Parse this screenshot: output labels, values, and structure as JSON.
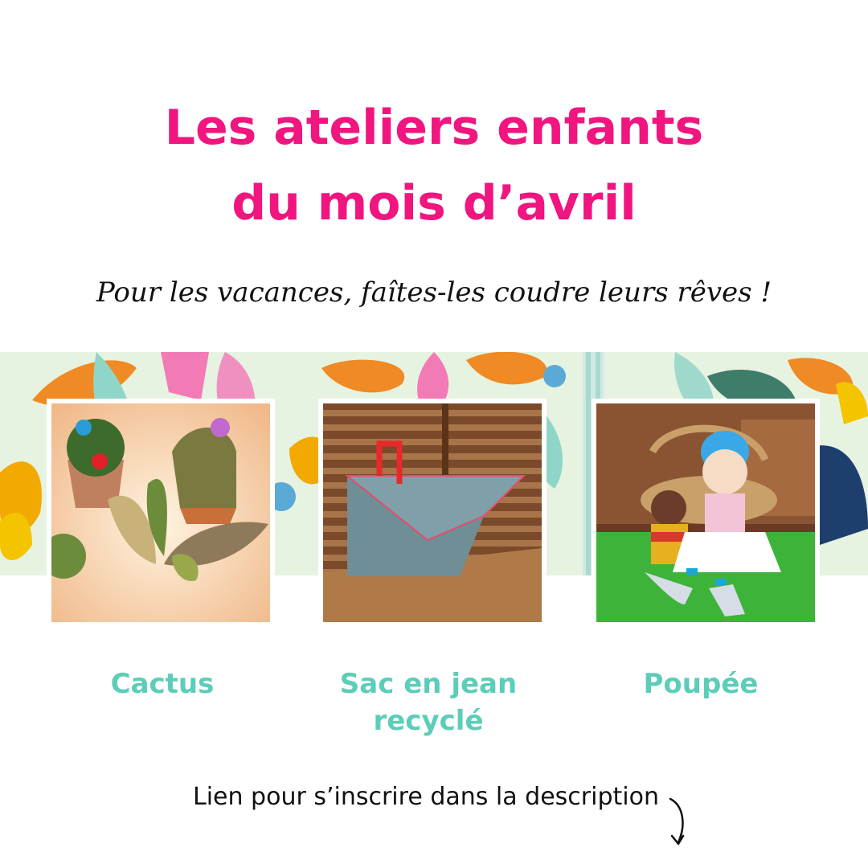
{
  "title": {
    "line1": "Les ateliers enfants",
    "line2": "du mois d’avril"
  },
  "subtitle": "Pour les vacances, faîtes-les coudre leurs rêves !",
  "workshops": [
    {
      "line1": "Cactus",
      "line2": ""
    },
    {
      "line1": "Sac en jean",
      "line2": "recyclé"
    },
    {
      "line1": "Poupée",
      "line2": ""
    }
  ],
  "footer": "Lien pour s’inscrire dans la description",
  "colors": {
    "title": "#f0157f",
    "caption": "#5ccdb8",
    "text": "#111111",
    "band_bg": "#e6f3e1"
  },
  "icons": {
    "arrow": "curved-arrow-down-icon"
  }
}
